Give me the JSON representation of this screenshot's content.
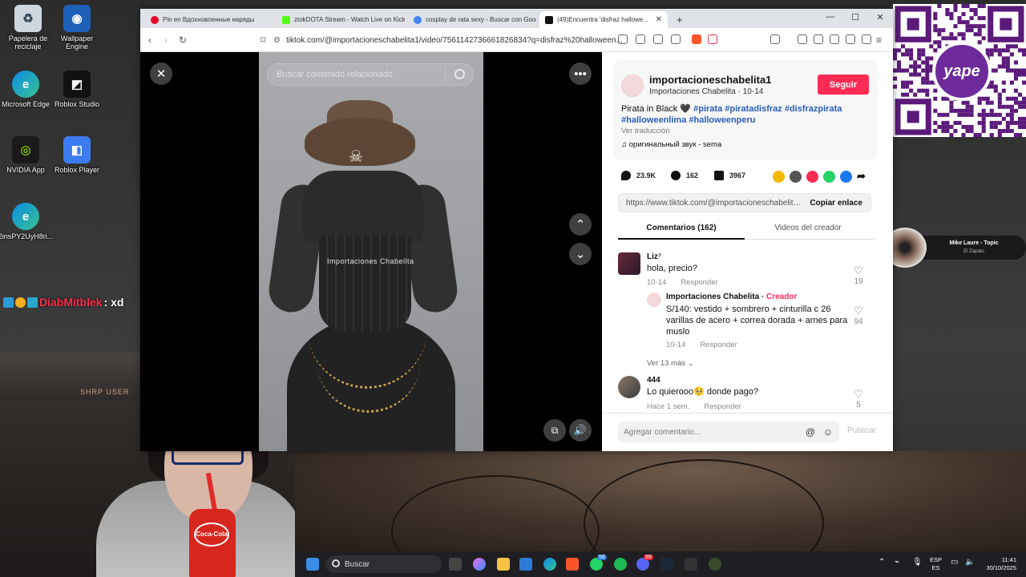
{
  "desktop": {
    "icons": [
      {
        "label": "Papelera de reciclaje",
        "icon": "recycle-bin-icon"
      },
      {
        "label": "Wallpaper Engine",
        "icon": "wallpaper-engine-icon"
      },
      {
        "label": "Microsoft Edge",
        "icon": "edge-icon"
      },
      {
        "label": "Roblox Studio",
        "icon": "roblox-studio-icon"
      },
      {
        "label": "NVIDIA App",
        "icon": "nvidia-icon"
      },
      {
        "label": "Roblox Player",
        "icon": "roblox-player-icon"
      },
      {
        "label": "2insPY2UyH8ri...",
        "icon": "edge-icon"
      }
    ],
    "stream_user": "DiabMitblek",
    "stream_message": ": xd",
    "webcam_overlay": "SHRP USER",
    "cup_label": "Coca-Cola"
  },
  "qr": {
    "brand": "yape"
  },
  "music": {
    "title": "Mike Laure - Topic",
    "subtitle": "El Zapato"
  },
  "browser": {
    "tabs": [
      {
        "title": "Pin en Вдохновленные наряды",
        "color": "#e60023"
      },
      {
        "title": "ztokDOTA Stream - Watch Live on Kick",
        "color": "#53fc18"
      },
      {
        "title": "cosplay de rata sexy - Buscar con Google",
        "color": "#4285f4"
      },
      {
        "title": "(49)Encuentra 'disfraz hallowe...",
        "color": "#111111"
      }
    ],
    "url": "tiktok.com/@importacioneschabelita1/video/7561142736661826834?q=disfraz%20halloween..."
  },
  "video": {
    "search_placeholder": "Buscar contenido relacionado",
    "watermark": "Importaciones Chabelita"
  },
  "post": {
    "username": "importacioneschabelita1",
    "display_name": "Importaciones Chabelita",
    "date": "10-14",
    "follow_label": "Seguir",
    "caption": "Pirata in Black 🖤",
    "hashtags_1": "#pirata #piratadisfraz #disfrazpirata",
    "hashtags_2": "#halloweenlima #halloweenperu",
    "translate": "Ver traducción",
    "sound": "оригинальный звук - sema",
    "likes": "23.9K",
    "comments": "162",
    "saves": "3967",
    "link": "https://www.tiktok.com/@importacioneschabelita...",
    "copy_label": "Copiar enlace",
    "tab_comments": "Comentarios (162)",
    "tab_videos": "Videos del creador"
  },
  "comments": [
    {
      "name": "Liz⁷",
      "text": "hola, precio?",
      "date": "10-14",
      "reply": "Responder",
      "likes": "19"
    },
    {
      "name": "Importaciones Chabelita",
      "badge": "Creador",
      "text": "S/140: vestido + sombrero + cinturilla c 26 varillas de acero + correa dorada + arnes para muslo",
      "date": "10-14",
      "reply": "Responder",
      "likes": "94"
    },
    {
      "name": "444",
      "text": "Lo quierooo🥺 donde pago?",
      "date": "Hace 1 sem.",
      "reply": "Responder",
      "likes": "5"
    }
  ],
  "more_replies": "Ver 13 más",
  "comment_placeholder": "Agregar comentario...",
  "publish_label": "Publicar",
  "taskbar": {
    "search_label": "Buscar",
    "lang_1": "ESP",
    "lang_2": "ES",
    "time": "11:41",
    "date": "30/10/2025",
    "badge_whatsapp": "58",
    "badge_discord": "99"
  }
}
